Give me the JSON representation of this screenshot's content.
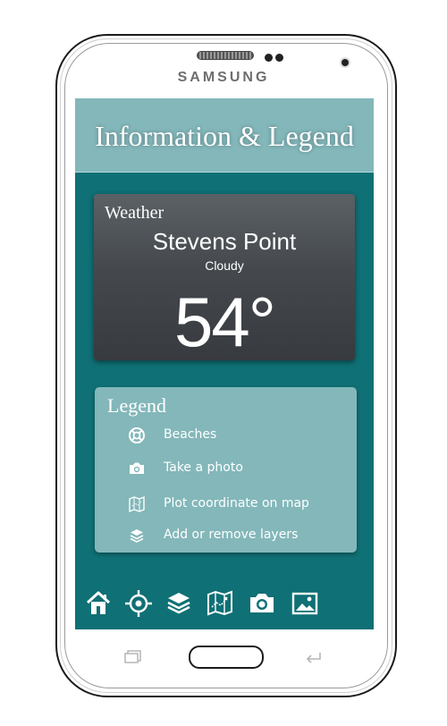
{
  "device": {
    "brand": "SAMSUNG"
  },
  "header": {
    "title": "Information & Legend"
  },
  "weather": {
    "label": "Weather",
    "city": "Stevens Point",
    "condition": "Cloudy",
    "temperature": "54°"
  },
  "legend": {
    "title": "Legend",
    "items": [
      {
        "icon": "lifebuoy-icon",
        "label": "Beaches"
      },
      {
        "icon": "camera-icon",
        "label": "Take a photo"
      },
      {
        "icon": "map-icon",
        "label": "Plot coordinate on map"
      },
      {
        "icon": "layers-icon",
        "label": "Add or remove layers"
      }
    ]
  },
  "toolbar": {
    "buttons": [
      "home-icon",
      "crosshair-icon",
      "layers-icon",
      "map-icon",
      "camera-icon",
      "image-icon"
    ]
  },
  "colors": {
    "screen_bg": "#0f7075",
    "header_bg": "#83b7ba",
    "card_bg": "#83b7ba",
    "weather_bg": "#45494d"
  }
}
